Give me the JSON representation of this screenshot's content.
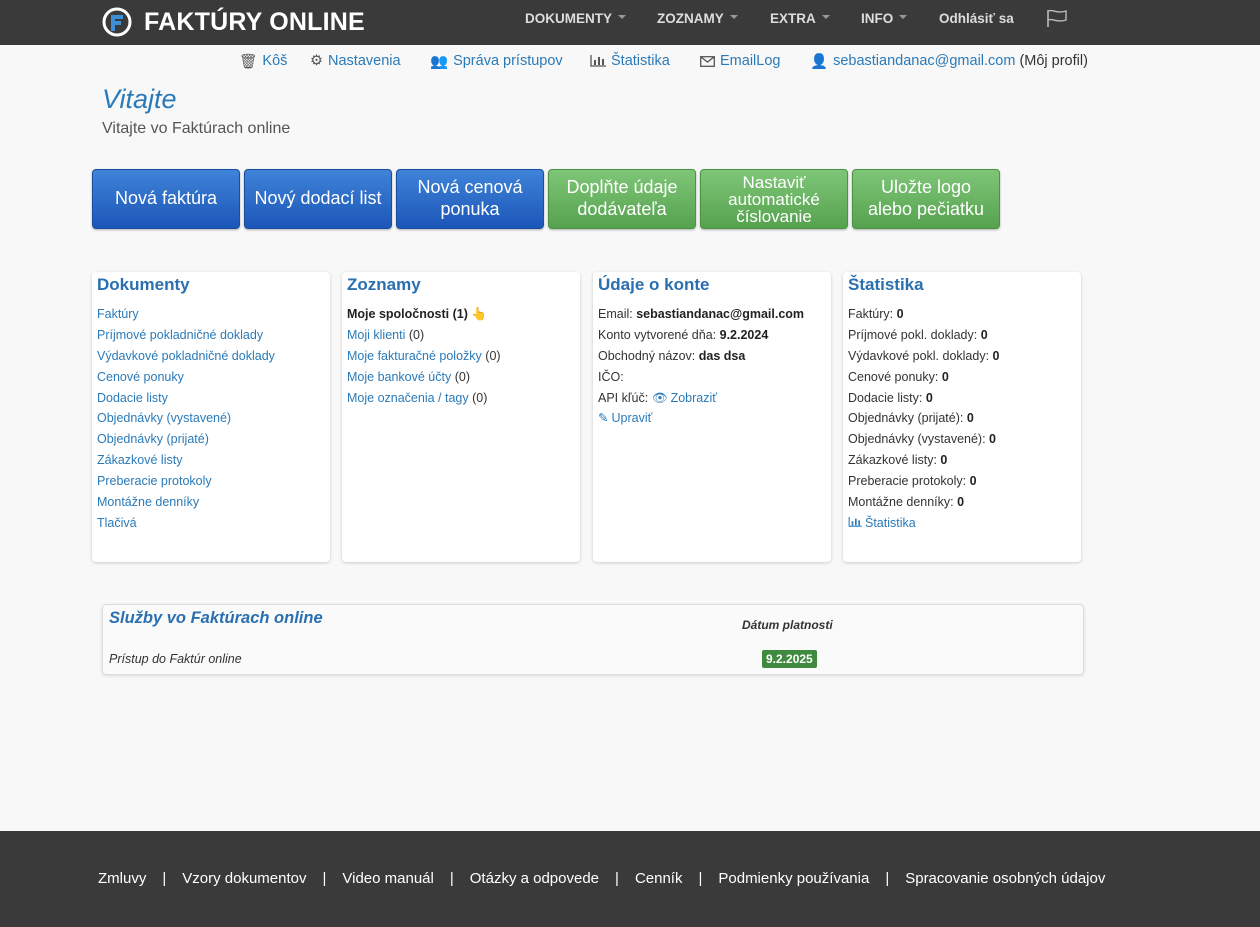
{
  "brand": {
    "name": "FAKTÚRY ONLINE"
  },
  "topnav": [
    {
      "label": "DOKUMENTY"
    },
    {
      "label": "ZOZNAMY"
    },
    {
      "label": "EXTRA"
    },
    {
      "label": "INFO"
    },
    {
      "label": "Odhlásiť sa"
    }
  ],
  "subnav": {
    "kos": "Kôš",
    "nastavenia": "Nastavenia",
    "sprava": "Správa prístupov",
    "statistika": "Štatistika",
    "emaillog": "EmailLog",
    "email": "sebastiandanac@gmail.com",
    "profile_suffix": "(Môj profil)"
  },
  "welcome": {
    "title": "Vitajte",
    "subtitle": "Vitajte vo Faktúrach online"
  },
  "buttons": [
    "Nová faktúra",
    "Nový dodací list",
    "Nová cenová ponuka",
    "Doplňte údaje dodávateľa",
    "Nastaviť automatické číslovanie",
    "Uložte logo alebo pečiatku"
  ],
  "dokumenty": {
    "title": "Dokumenty",
    "items": [
      "Faktúry",
      "Príjmové pokladničné doklady",
      "Výdavkové pokladničné doklady",
      "Cenové ponuky",
      "Dodacie listy",
      "Objednávky (vystavené)",
      "Objednávky (prijaté)",
      "Zákazkové listy",
      "Preberacie protokoly",
      "Montážne denníky",
      "Tlačivá"
    ]
  },
  "zoznamy": {
    "title": "Zoznamy",
    "companies_label": "Moje spoločnosti",
    "companies_count": "(1)",
    "items": [
      {
        "label": "Moji klienti",
        "count": "(0)"
      },
      {
        "label": "Moje fakturačné položky",
        "count": "(0)"
      },
      {
        "label": "Moje bankové účty",
        "count": "(0)"
      },
      {
        "label": "Moje označenia / tagy",
        "count": "(0)"
      }
    ]
  },
  "konto": {
    "title": "Údaje o konte",
    "email_label": "Email:",
    "email_value": "sebastiandanac@gmail.com",
    "created_label": "Konto vytvorené dňa:",
    "created_value": "9.2.2024",
    "business_label": "Obchodný názov:",
    "business_value": "das dsa",
    "ico_label": "IČO:",
    "api_label": "API kľúč:",
    "api_link": "Zobraziť",
    "edit_link": "Upraviť"
  },
  "statistika": {
    "title": "Štatistika",
    "items": [
      {
        "label": "Faktúry:",
        "value": "0"
      },
      {
        "label": "Príjmové pokl. doklady:",
        "value": "0"
      },
      {
        "label": "Výdavkové pokl. doklady:",
        "value": "0"
      },
      {
        "label": "Cenové ponuky:",
        "value": "0"
      },
      {
        "label": "Dodacie listy:",
        "value": "0"
      },
      {
        "label": "Objednávky (prijaté):",
        "value": "0"
      },
      {
        "label": "Objednávky (vystavené):",
        "value": "0"
      },
      {
        "label": "Zákazkové listy:",
        "value": "0"
      },
      {
        "label": "Preberacie protokoly:",
        "value": "0"
      },
      {
        "label": "Montážne denníky:",
        "value": "0"
      }
    ],
    "link": "Štatistika"
  },
  "services": {
    "title": "Služby vo Faktúrach online",
    "col_head": "Dátum platnosti",
    "row_label": "Prístup do Faktúr online",
    "row_value": "9.2.2025",
    "badge_color": "#3f8a3f"
  },
  "footer": [
    "Zmluvy",
    "Vzory dokumentov",
    "Video manuál",
    "Otázky a odpovede",
    "Cenník",
    "Podmienky používania",
    "Spracovanie osobných údajov"
  ],
  "footer_separator": "|",
  "colors": {
    "brand_blue": "#2a7ab8",
    "navbar": "#3a3a3a",
    "button_blue": "#1c56b8",
    "button_green": "#55a24f"
  },
  "icons": [
    "trash-icon",
    "gear-icon",
    "users-icon",
    "bar-chart-icon",
    "envelope-icon",
    "user-icon",
    "flag-icon",
    "hand-pointer-icon",
    "eye-icon",
    "pencil-icon"
  ]
}
